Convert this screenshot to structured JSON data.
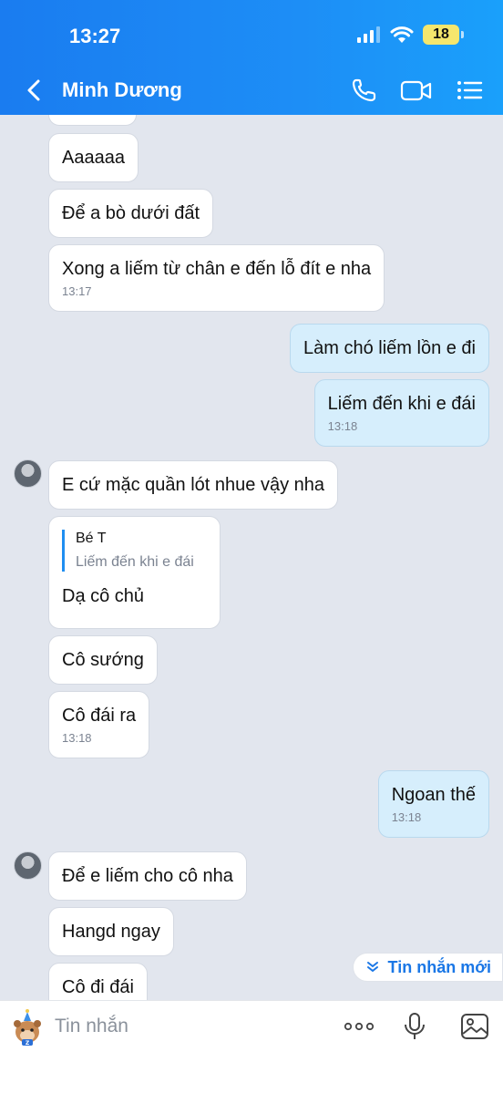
{
  "status_bar": {
    "time": "13:27",
    "battery": "18"
  },
  "header": {
    "contact_name": "Minh Dương"
  },
  "messages": [
    {
      "sender": "them",
      "text": ""
    },
    {
      "sender": "them",
      "text": "Aaaaaa"
    },
    {
      "sender": "them",
      "text": "Để a bò dưới đất"
    },
    {
      "sender": "them",
      "text": "Xong a liếm từ chân e đến lỗ đít e nha",
      "time": "13:17"
    },
    {
      "sender": "me",
      "text": "Làm chó liếm lồn e đi"
    },
    {
      "sender": "me",
      "text": "Liếm đến khi e đái",
      "time": "13:18"
    },
    {
      "sender": "them",
      "text": "E cứ mặc quần lót nhue vậy nha"
    },
    {
      "sender": "them",
      "quote_name": "Bé T",
      "quote_text": "Liếm đến khi e đái",
      "text": "Dạ cô chủ"
    },
    {
      "sender": "them",
      "text": "Cô sướng"
    },
    {
      "sender": "them",
      "text": "Cô đái ra",
      "time": "13:18"
    },
    {
      "sender": "me",
      "text": "Ngoan thế",
      "time": "13:18"
    },
    {
      "sender": "them",
      "text": "Để e liếm cho cô nha"
    },
    {
      "sender": "them",
      "text": "Hangd ngay"
    },
    {
      "sender": "them",
      "text": "Cô đi đái"
    }
  ],
  "new_messages_label": "Tin nhắn mới",
  "input": {
    "placeholder": "Tin nhắn"
  },
  "icons": {
    "back": "chevron-left-icon",
    "call": "phone-icon",
    "video": "video-camera-icon",
    "menu": "list-menu-icon",
    "sticker": "sticker-icon",
    "more": "more-dots-icon",
    "mic": "microphone-icon",
    "image": "image-icon",
    "new_messages": "double-chevron-down-icon"
  },
  "colors": {
    "header": "#1d8ef6",
    "my_bubble": "#d6eefc",
    "their_bubble": "#ffffff",
    "chat_bg": "#e2e6ee",
    "accent": "#1a77e6"
  }
}
